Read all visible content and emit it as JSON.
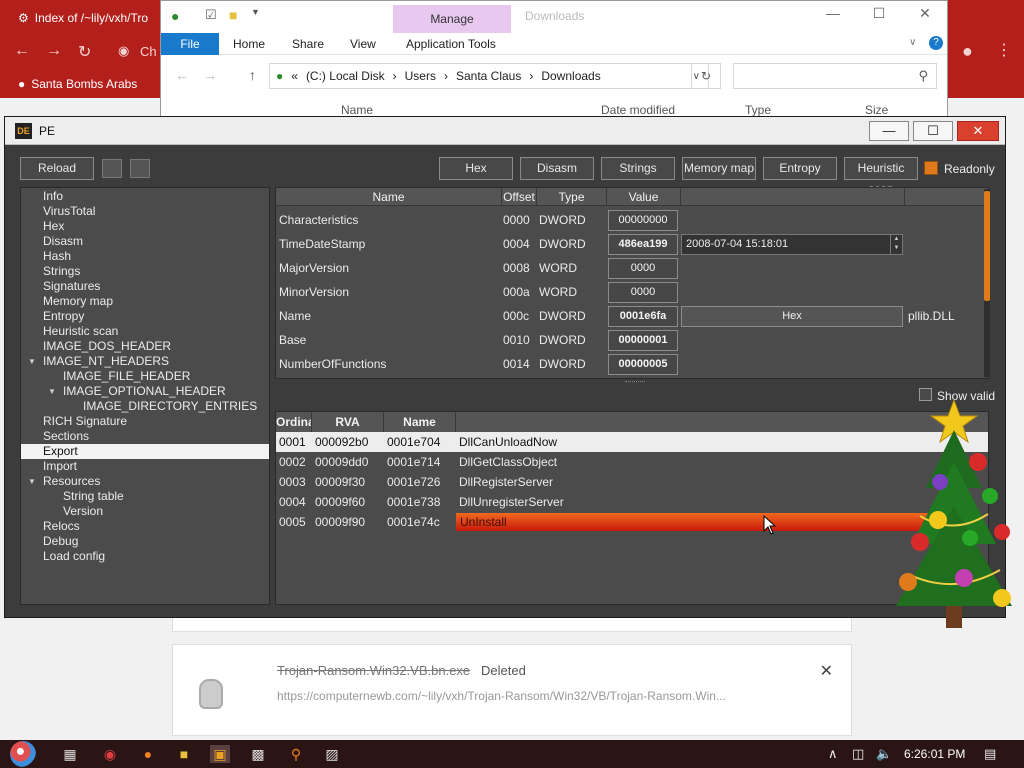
{
  "browser": {
    "tab_title": "Index of /~lily/vxh/Tro",
    "tab2_title": "Ch",
    "bookmark": "Santa Bombs Arabs",
    "download": {
      "filename": "Trojan-Ransom.Win32.VB.bn.exe",
      "status": "Deleted",
      "url": "https://computernewb.com/~lily/vxh/Trojan-Ransom/Win32/VB/Trojan-Ransom.Win..."
    }
  },
  "explorer": {
    "manage_tab": "Manage",
    "title": "Downloads",
    "ribbon": [
      "File",
      "Home",
      "Share",
      "View",
      "Application Tools"
    ],
    "address": [
      "«",
      "(C:) Local Disk",
      "›",
      "Users",
      "›",
      "Santa Claus",
      "›",
      "Downloads"
    ],
    "columns": [
      "Name",
      "Date modified",
      "Type",
      "Size"
    ]
  },
  "pe": {
    "title": "PE",
    "logo_text": "DE",
    "toolbar": {
      "reload": "Reload",
      "hex": "Hex",
      "disasm": "Disasm",
      "strings": "Strings",
      "memory_map": "Memory map",
      "entropy": "Entropy",
      "heuristic_scan": "Heuristic scan",
      "readonly": "Readonly"
    },
    "tree": [
      {
        "label": "Info",
        "indent": 0
      },
      {
        "label": "VirusTotal",
        "indent": 0
      },
      {
        "label": "Hex",
        "indent": 0
      },
      {
        "label": "Disasm",
        "indent": 0
      },
      {
        "label": "Hash",
        "indent": 0
      },
      {
        "label": "Strings",
        "indent": 0
      },
      {
        "label": "Signatures",
        "indent": 0
      },
      {
        "label": "Memory map",
        "indent": 0
      },
      {
        "label": "Entropy",
        "indent": 0
      },
      {
        "label": "Heuristic scan",
        "indent": 0
      },
      {
        "label": "IMAGE_DOS_HEADER",
        "indent": 0
      },
      {
        "label": "IMAGE_NT_HEADERS",
        "indent": 0,
        "expanded": true
      },
      {
        "label": "IMAGE_FILE_HEADER",
        "indent": 1
      },
      {
        "label": "IMAGE_OPTIONAL_HEADER",
        "indent": 1,
        "expanded": true
      },
      {
        "label": "IMAGE_DIRECTORY_ENTRIES",
        "indent": 2
      },
      {
        "label": "RICH Signature",
        "indent": 0
      },
      {
        "label": "Sections",
        "indent": 0
      },
      {
        "label": "Export",
        "indent": 0,
        "selected": true
      },
      {
        "label": "Import",
        "indent": 0
      },
      {
        "label": "Resources",
        "indent": 0,
        "expanded": true
      },
      {
        "label": "String table",
        "indent": 1
      },
      {
        "label": "Version",
        "indent": 1
      },
      {
        "label": "Relocs",
        "indent": 0
      },
      {
        "label": "Debug",
        "indent": 0
      },
      {
        "label": "Load config",
        "indent": 0
      }
    ],
    "header_columns": [
      "Name",
      "Offset",
      "Type",
      "Value"
    ],
    "header_rows": [
      {
        "name": "Characteristics",
        "offset": "0000",
        "type": "DWORD",
        "value": "00000000",
        "bold": false
      },
      {
        "name": "TimeDateStamp",
        "offset": "0004",
        "type": "DWORD",
        "value": "486ea199",
        "bold": true,
        "extra": "2008-07-04 15:18:01"
      },
      {
        "name": "MajorVersion",
        "offset": "0008",
        "type": "WORD",
        "value": "0000",
        "bold": false
      },
      {
        "name": "MinorVersion",
        "offset": "000a",
        "type": "WORD",
        "value": "0000",
        "bold": false
      },
      {
        "name": "Name",
        "offset": "000c",
        "type": "DWORD",
        "value": "0001e6fa",
        "bold": true,
        "hex_button": "Hex",
        "dll": "pllib.DLL"
      },
      {
        "name": "Base",
        "offset": "0010",
        "type": "DWORD",
        "value": "00000001",
        "bold": true
      },
      {
        "name": "NumberOfFunctions",
        "offset": "0014",
        "type": "DWORD",
        "value": "00000005",
        "bold": true
      }
    ],
    "show_valid": "Show valid",
    "export_columns": [
      "Ordina",
      "RVA",
      "Name"
    ],
    "export_rows": [
      {
        "ordinal": "0001",
        "rva": "000092b0",
        "name": "0001e704",
        "func": "DllCanUnloadNow",
        "selected": true
      },
      {
        "ordinal": "0002",
        "rva": "00009dd0",
        "name": "0001e714",
        "func": "DllGetClassObject"
      },
      {
        "ordinal": "0003",
        "rva": "00009f30",
        "name": "0001e726",
        "func": "DllRegisterServer"
      },
      {
        "ordinal": "0004",
        "rva": "00009f60",
        "name": "0001e738",
        "func": "DllUnregisterServer"
      },
      {
        "ordinal": "0005",
        "rva": "00009f90",
        "name": "0001e74c",
        "func": "UnInstall",
        "hovered": true
      }
    ]
  },
  "taskbar": {
    "time": "6:26:01 PM"
  },
  "colors": {
    "browser_red": "#b3201c",
    "accent_orange": "#e07b1c",
    "hover_red": "#c8190e",
    "explorer_blue": "#1979ca"
  }
}
